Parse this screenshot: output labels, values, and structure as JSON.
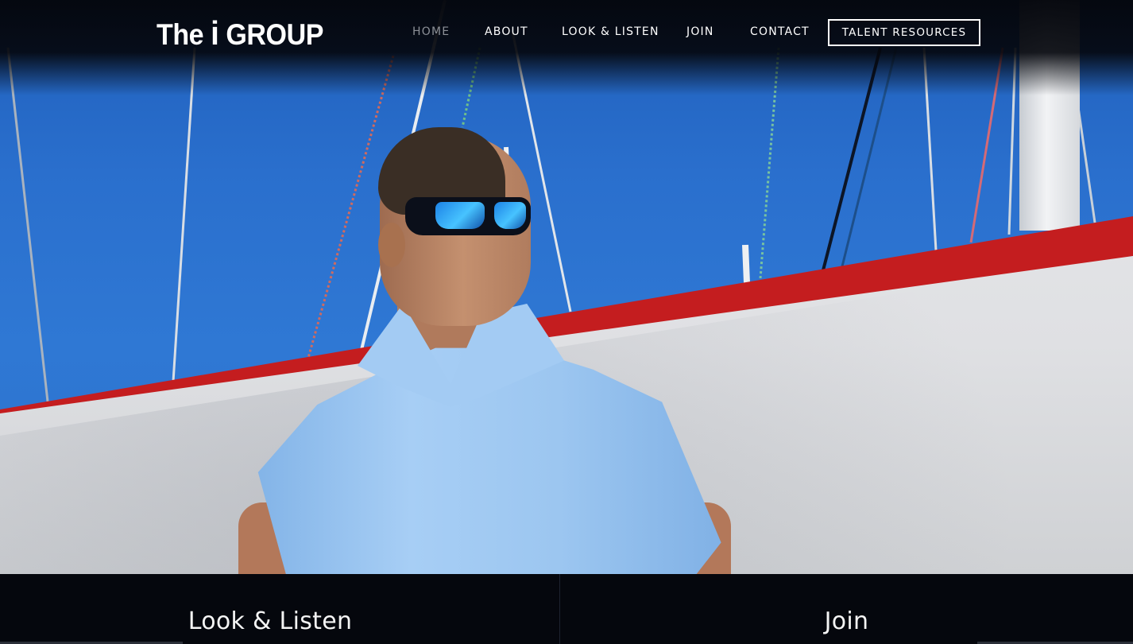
{
  "brand": {
    "logo_text_before": "The",
    "logo_text_i": "i",
    "logo_text_after": "GROUP"
  },
  "nav": {
    "items": [
      {
        "label": "HOME",
        "active": true
      },
      {
        "label": "ABOUT",
        "active": false
      },
      {
        "label": "LOOK & LISTEN",
        "active": false
      },
      {
        "label": "JOIN",
        "active": false
      },
      {
        "label": "CONTACT",
        "active": false
      }
    ],
    "cta_label": "TALENT RESOURCES"
  },
  "panels": {
    "left_title": "Look & Listen",
    "right_title": "Join"
  },
  "colors": {
    "header_bg": "#04060c",
    "sky": "#2a6fcd",
    "sail_trim": "#c41d1f",
    "shirt": "#9cc6f0",
    "panel_bg": "#05070d",
    "nav_active": "#8c9097"
  }
}
